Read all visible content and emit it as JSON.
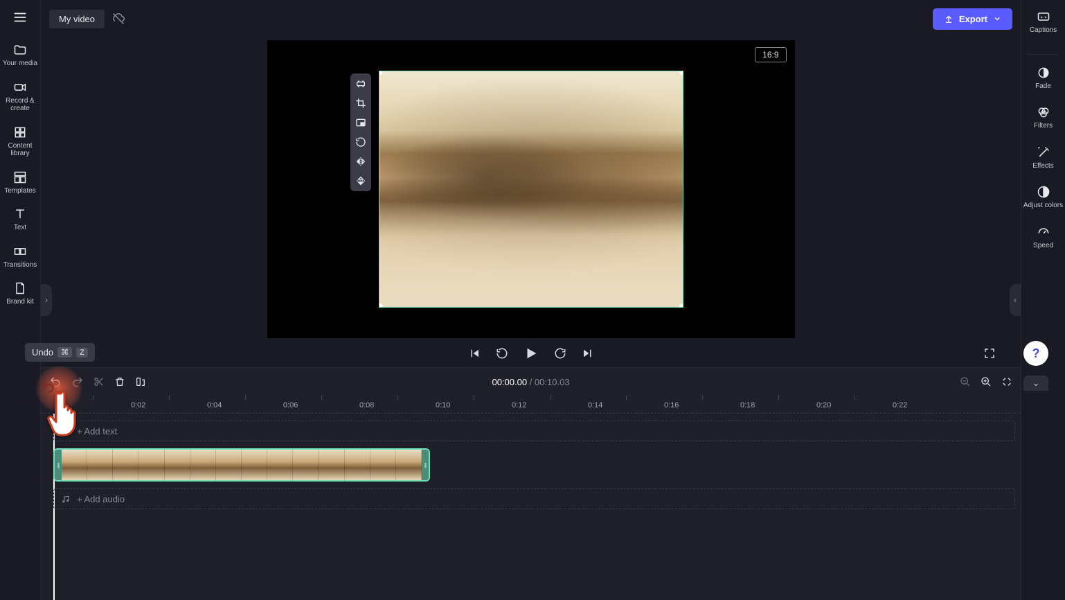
{
  "header": {
    "project_name": "My video",
    "export_label": "Export",
    "aspect_ratio": "16:9"
  },
  "left_rail": {
    "items": [
      {
        "label": "Your media"
      },
      {
        "label": "Record & create"
      },
      {
        "label": "Content library"
      },
      {
        "label": "Templates"
      },
      {
        "label": "Text"
      },
      {
        "label": "Transitions"
      },
      {
        "label": "Brand kit"
      }
    ]
  },
  "right_rail": {
    "items": [
      {
        "label": "Captions"
      },
      {
        "label": "Fade"
      },
      {
        "label": "Filters"
      },
      {
        "label": "Effects"
      },
      {
        "label": "Adjust colors"
      },
      {
        "label": "Speed"
      }
    ]
  },
  "floating_tools": [
    "fit-icon",
    "crop-icon",
    "pip-icon",
    "rotate-icon",
    "flip-horizontal-icon",
    "flip-vertical-icon"
  ],
  "timeline": {
    "current_time": "00:00.00",
    "total_time": "00:10.03",
    "ruler_labels": [
      "0:02",
      "0:04",
      "0:06",
      "0:08",
      "0:10",
      "0:12",
      "0:14",
      "0:16",
      "0:18",
      "0:20",
      "0:22"
    ],
    "add_text_label": "+ Add text",
    "add_audio_label": "+ Add audio"
  },
  "tooltip": {
    "label": "Undo",
    "mod_key": "⌘",
    "key": "Z"
  },
  "help": {
    "label": "?"
  }
}
